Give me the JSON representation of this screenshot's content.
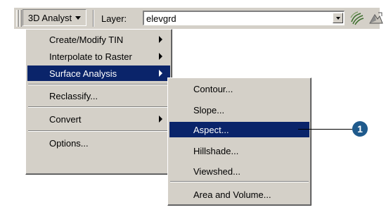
{
  "toolbar": {
    "extension_menu_label": "3D Analyst",
    "layer_label": "Layer:",
    "layer_value": "elevgrd",
    "tools": [
      "contour-tool-icon",
      "aspect-tool-icon"
    ]
  },
  "menu": {
    "items": [
      {
        "label": "Create/Modify TIN",
        "submenu": true
      },
      {
        "label": "Interpolate to Raster",
        "submenu": true
      },
      {
        "label": "Surface Analysis",
        "submenu": true,
        "active": true
      },
      {
        "label": "Reclassify...",
        "submenu": false
      },
      {
        "label": "Convert",
        "submenu": true
      },
      {
        "label": "Options...",
        "submenu": false
      }
    ]
  },
  "submenu": {
    "items": [
      {
        "label": "Contour..."
      },
      {
        "label": "Slope..."
      },
      {
        "label": "Aspect...",
        "active": true
      },
      {
        "label": "Hillshade..."
      },
      {
        "label": "Viewshed..."
      },
      {
        "label": "Area and Volume..."
      }
    ]
  },
  "callout": {
    "number": "1"
  },
  "colors": {
    "menu_face": "#d4d0c8",
    "highlight": "#0a246a",
    "callout": "#1f5a8c"
  }
}
